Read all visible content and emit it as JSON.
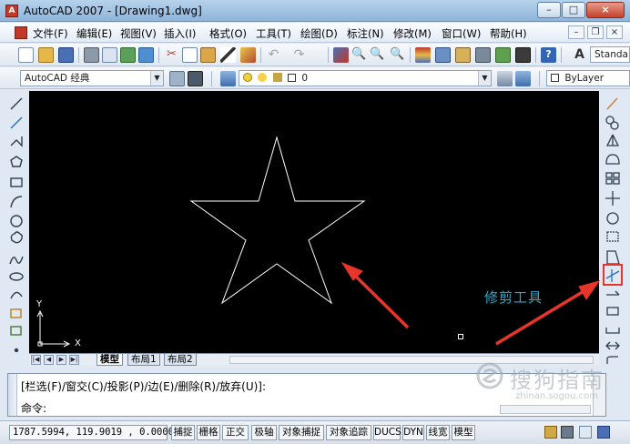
{
  "window": {
    "app_icon": "autocad-app-icon",
    "title": "AutoCAD 2007 - [Drawing1.dwg]",
    "min_label": "–",
    "max_label": "□",
    "close_label": "×"
  },
  "menu": {
    "items": [
      "文件(F)",
      "编辑(E)",
      "视图(V)",
      "插入(I)",
      "格式(O)",
      "工具(T)",
      "绘图(D)",
      "标注(N)",
      "修改(M)",
      "窗口(W)",
      "帮助(H)"
    ],
    "mdi_min": "–",
    "mdi_restore": "❐",
    "mdi_close": "×"
  },
  "toolbar1": {
    "style_combo": "Standa"
  },
  "toolbar2": {
    "workspace_combo": "AutoCAD 经典",
    "layer_combo": "0",
    "color_combo": "ByLayer"
  },
  "canvas": {
    "background": "#000000",
    "ucs_y_label": "Y",
    "ucs_x_label": "X",
    "annotation_label": "修剪工具",
    "annotation_color": "#2fa8c9",
    "arrow_color": "#e8352c"
  },
  "layout_tabs": [
    "模型",
    "布局1",
    "布局2"
  ],
  "command": {
    "line1": "[栏选(F)/窗交(C)/投影(P)/边(E)/删除(R)/放弃(U)]:",
    "line2": "命令:"
  },
  "status": {
    "coords": "1787.5994, 119.9019 , 0.0000",
    "toggles": [
      "捕捉",
      "栅格",
      "正交",
      "极轴",
      "对象捕捉",
      "对象追踪",
      "DUCS",
      "DYN",
      "线宽",
      "模型"
    ]
  },
  "watermark": {
    "text": "搜狗指南",
    "url": "zhinan.sogou.com"
  }
}
